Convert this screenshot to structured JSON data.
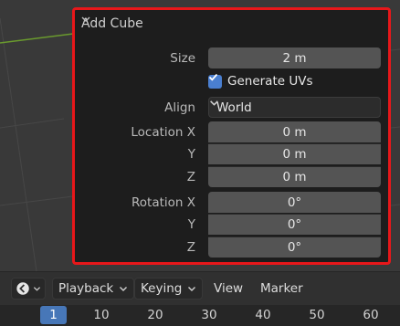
{
  "operator_panel": {
    "title": "Add Cube",
    "size": {
      "label": "Size",
      "value": "2 m"
    },
    "generate_uvs": {
      "label": "Generate UVs",
      "checked": true
    },
    "align": {
      "label": "Align",
      "value": "World"
    },
    "location": {
      "labels": [
        "Location X",
        "Y",
        "Z"
      ],
      "values": [
        "0 m",
        "0 m",
        "0 m"
      ]
    },
    "rotation": {
      "labels": [
        "Rotation X",
        "Y",
        "Z"
      ],
      "values": [
        "0°",
        "0°",
        "0°"
      ]
    }
  },
  "timeline": {
    "menus": [
      "Playback",
      "Keying",
      "View",
      "Marker"
    ],
    "frames": [
      "10",
      "20",
      "30",
      "40",
      "50",
      "60"
    ],
    "current_frame": "1"
  },
  "colors": {
    "highlight_border": "#e8171a",
    "checkbox_accent": "#4a7fd0",
    "current_frame": "#4777b8"
  }
}
